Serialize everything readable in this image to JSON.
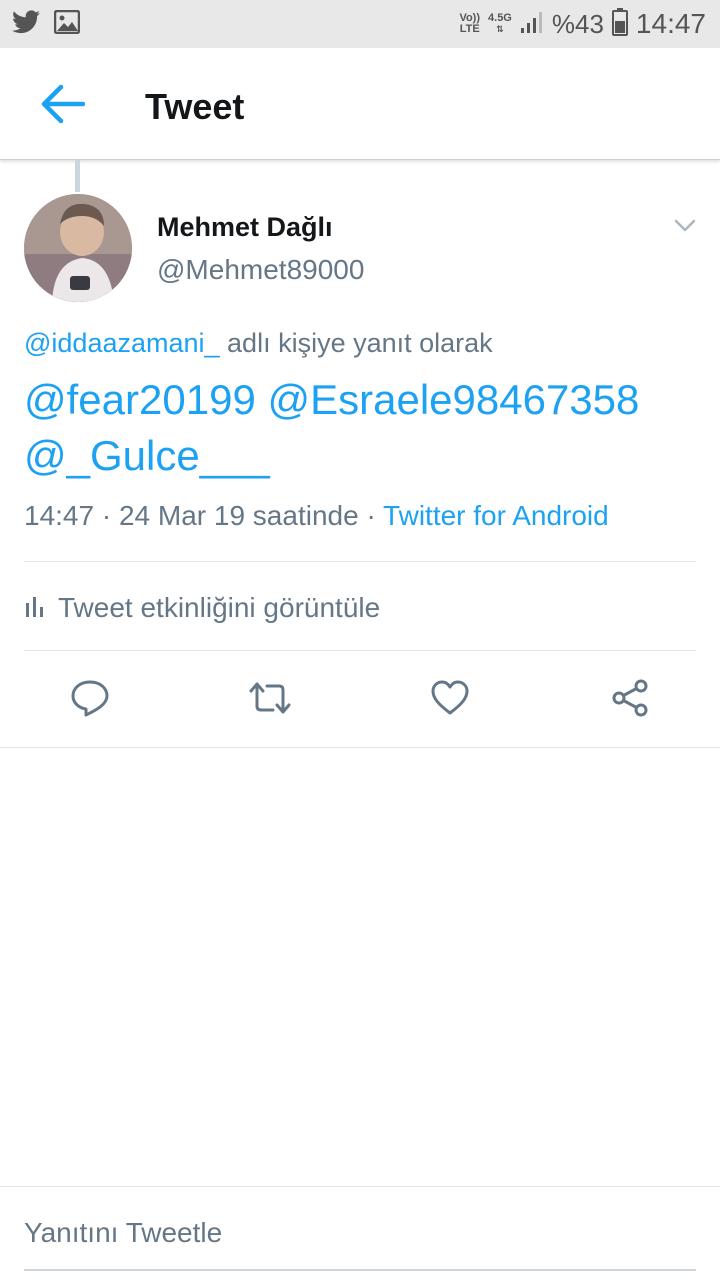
{
  "status_bar": {
    "volte_top": "Vo))",
    "volte_bottom": "LTE",
    "network": "4.5G",
    "battery_percent": "%43",
    "time": "14:47",
    "icons": [
      "twitter-bird-icon",
      "image-icon",
      "signal-icon",
      "battery-icon"
    ]
  },
  "app_bar": {
    "title": "Tweet"
  },
  "tweet": {
    "display_name": "Mehmet Dağlı",
    "handle": "@Mehmet89000",
    "reply_to_mention": "@iddaazamani_",
    "reply_to_suffix": " adlı kişiye yanıt olarak",
    "text": "@fear20199 @Esraele98467358 @_Gulce___",
    "time_date": "14:47 · 24 Mar 19 saatinde · ",
    "source": "Twitter for Android",
    "activity_label": "Tweet etkinliğini görüntüle"
  },
  "reply_bar": {
    "placeholder": "Yanıtını Tweetle"
  },
  "colors": {
    "accent": "#1da1f2",
    "secondary_text": "#657786",
    "primary_text": "#14171a",
    "divider": "#e1e8ed"
  }
}
